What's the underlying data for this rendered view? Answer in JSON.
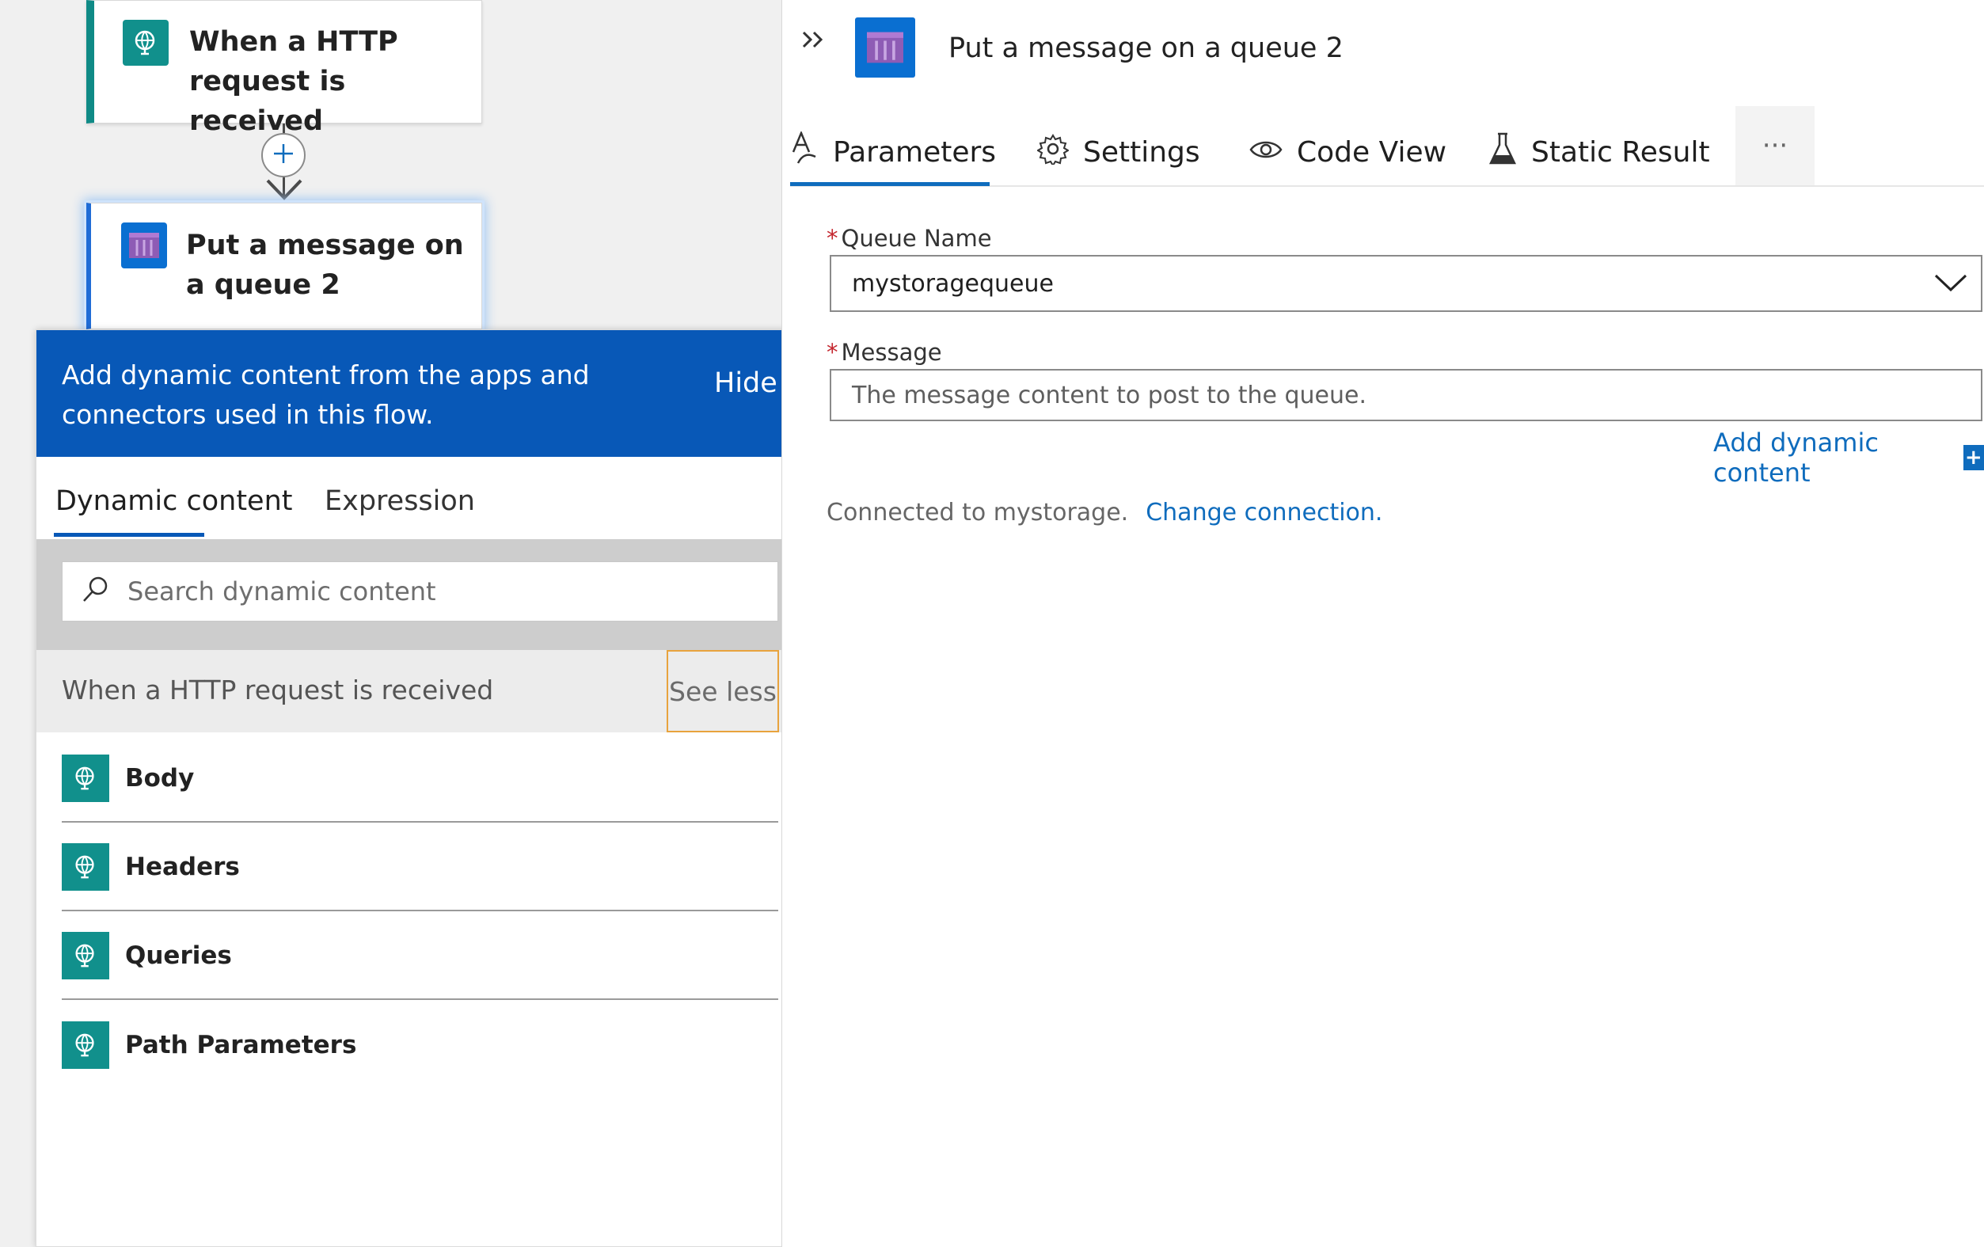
{
  "canvas": {
    "trigger_card": {
      "title": "When a HTTP request is received",
      "icon": "http-globe-icon"
    },
    "action_card": {
      "title": "Put a message on a queue 2",
      "icon": "storage-queue-icon"
    },
    "connector": {
      "icon": "plus-icon"
    }
  },
  "flyout": {
    "header_text": "Add dynamic content from the apps and connectors used in this flow.",
    "hide_label": "Hide",
    "tabs": [
      {
        "label": "Dynamic content",
        "active": true
      },
      {
        "label": "Expression",
        "active": false
      }
    ],
    "search": {
      "placeholder": "Search dynamic content"
    },
    "group": {
      "title": "When a HTTP request is received",
      "toggle_label": "See less",
      "items": [
        {
          "label": "Body",
          "icon": "http-globe-icon"
        },
        {
          "label": "Headers",
          "icon": "http-globe-icon"
        },
        {
          "label": "Queries",
          "icon": "http-globe-icon"
        },
        {
          "label": "Path Parameters",
          "icon": "http-globe-icon"
        }
      ]
    }
  },
  "panel": {
    "title": "Put a message on a queue 2",
    "tabs": [
      {
        "label": "Parameters",
        "icon": "parameters-icon",
        "active": true
      },
      {
        "label": "Settings",
        "icon": "gear-icon"
      },
      {
        "label": "Code View",
        "icon": "eye-icon"
      },
      {
        "label": "Static Result",
        "icon": "flask-icon"
      }
    ],
    "more_label": "···",
    "fields": {
      "queue_name": {
        "label": "Queue Name",
        "required": "*",
        "value": "mystoragequeue"
      },
      "message": {
        "label": "Message",
        "required": "*",
        "placeholder": "The message content to post to the queue."
      }
    },
    "add_dynamic_content": "Add dynamic content",
    "add_dynamic_plus": "+",
    "connection": {
      "text": "Connected to mystorage.",
      "link": "Change connection."
    }
  },
  "colors": {
    "accent": "#0858b7",
    "link": "#0f6cbd",
    "http_teal": "#11908c",
    "required": "#c4262e"
  }
}
